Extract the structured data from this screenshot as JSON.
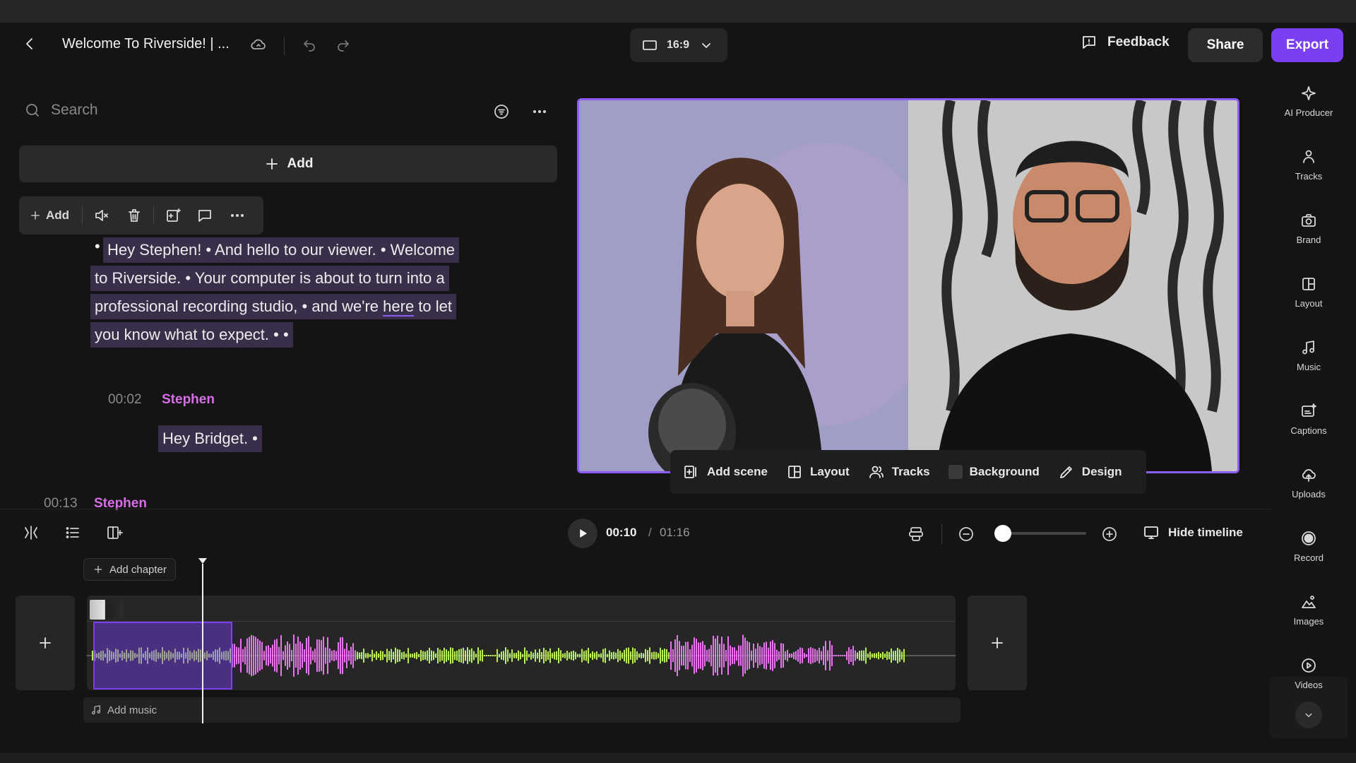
{
  "header": {
    "title": "Welcome To Riverside! | ...",
    "aspect_ratio": "16:9",
    "feedback_label": "Feedback",
    "share_label": "Share",
    "export_label": "Export"
  },
  "transcript": {
    "search_placeholder": "Search",
    "add_label": "Add",
    "toolbar": {
      "add_label": "Add"
    },
    "segment1_lines": [
      "Hey Stephen! • And hello to our viewer. • Welcome",
      "to Riverside. • Your computer is about to turn into a",
      "professional recording studio, • and we're",
      "here",
      " to let",
      "you know what to expect. • •"
    ],
    "segment2": {
      "time": "00:02",
      "speaker": "Stephen",
      "text": "Hey Bridget. •"
    },
    "segment3": {
      "time": "00:13",
      "speaker": "Stephen"
    }
  },
  "scene_bar": {
    "add_scene": "Add scene",
    "layout": "Layout",
    "tracks": "Tracks",
    "background": "Background",
    "design": "Design"
  },
  "transport": {
    "current_time": "00:10",
    "separator": "/",
    "total_time": "01:16",
    "zoom_level": 0.05,
    "hide_timeline_label": "Hide timeline"
  },
  "timeline": {
    "add_chapter_label": "Add chapter",
    "add_music_label": "Add music",
    "playhead_time": "00:10"
  },
  "right_rail": [
    {
      "label": "AI Producer",
      "icon": "sparkle-icon"
    },
    {
      "label": "Tracks",
      "icon": "people-icon"
    },
    {
      "label": "Brand",
      "icon": "brand-icon"
    },
    {
      "label": "Layout",
      "icon": "layout-icon"
    },
    {
      "label": "Music",
      "icon": "music-note-icon"
    },
    {
      "label": "Captions",
      "icon": "captions-icon"
    },
    {
      "label": "Uploads",
      "icon": "upload-icon"
    },
    {
      "label": "Record",
      "icon": "record-icon"
    },
    {
      "label": "Images",
      "icon": "images-icon"
    },
    {
      "label": "Videos",
      "icon": "video-play-icon"
    }
  ],
  "colors": {
    "accent": "#7b3ff2",
    "speaker": "#d86de8",
    "waveform_green": "#b8f05a",
    "waveform_pink": "#e874f0"
  }
}
